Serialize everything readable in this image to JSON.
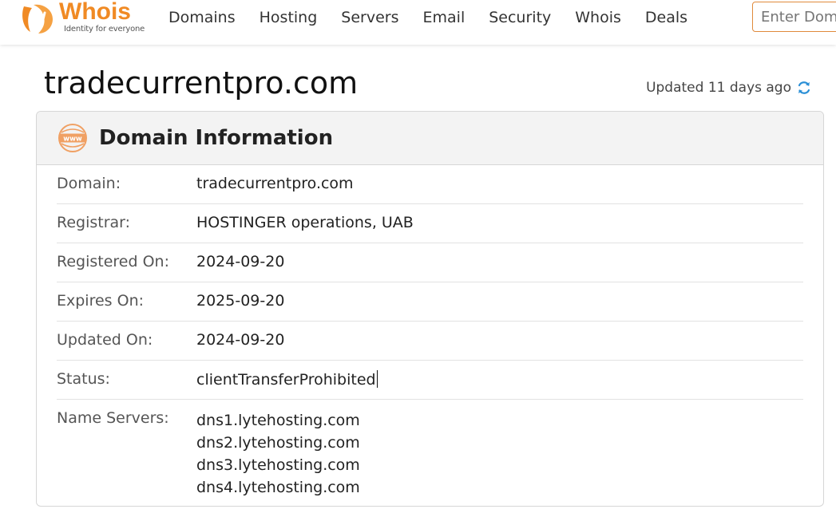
{
  "header": {
    "logo_text": "Whois",
    "logo_tagline": "Identity for everyone",
    "nav": [
      "Domains",
      "Hosting",
      "Servers",
      "Email",
      "Security",
      "Whois",
      "Deals"
    ],
    "search_placeholder": "Enter Domain or IP"
  },
  "page": {
    "domain": "tradecurrentpro.com",
    "updated_text": "Updated 11 days ago"
  },
  "card": {
    "title": "Domain Information",
    "rows": [
      {
        "label": "Domain:",
        "value": "tradecurrentpro.com"
      },
      {
        "label": "Registrar:",
        "value": "HOSTINGER operations, UAB"
      },
      {
        "label": "Registered On:",
        "value": "2024-09-20"
      },
      {
        "label": "Expires On:",
        "value": "2025-09-20"
      },
      {
        "label": "Updated On:",
        "value": "2024-09-20"
      },
      {
        "label": "Status:",
        "value": "clientTransferProhibited"
      }
    ],
    "name_servers_label": "Name Servers:",
    "name_servers": [
      "dns1.lytehosting.com",
      "dns2.lytehosting.com",
      "dns3.lytehosting.com",
      "dns4.lytehosting.com"
    ]
  },
  "colors": {
    "brand": "#f08a24",
    "refresh": "#2a8fd6"
  }
}
